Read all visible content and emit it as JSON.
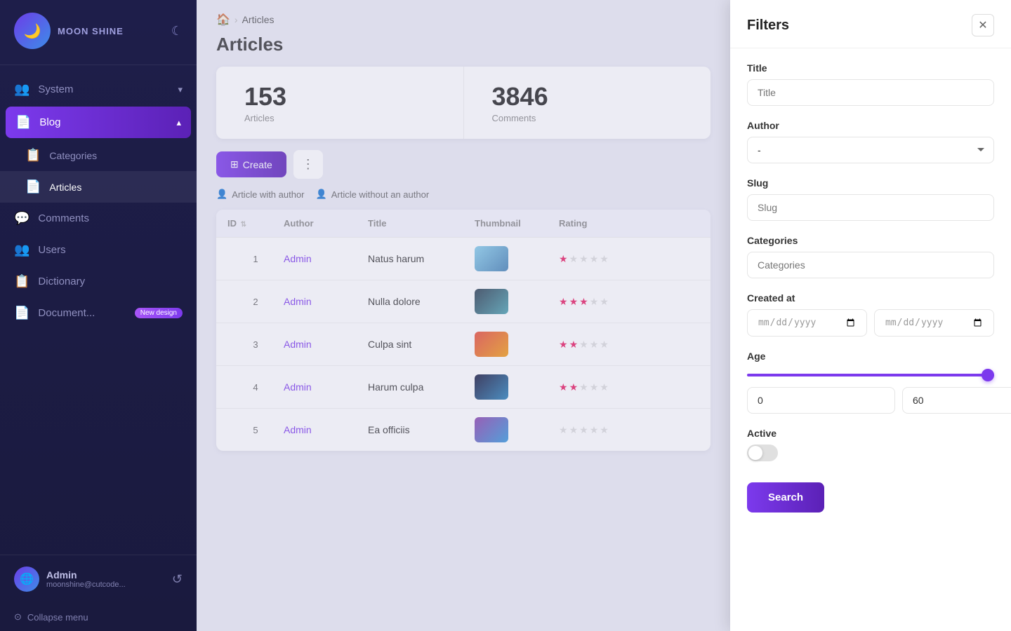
{
  "sidebar": {
    "logo": {
      "icon": "🌙",
      "text": "MOON SHINE"
    },
    "theme_icon": "☾",
    "nav": [
      {
        "id": "system",
        "label": "System",
        "icon": "👥",
        "hasChevron": true,
        "active": false
      },
      {
        "id": "blog",
        "label": "Blog",
        "icon": "📄",
        "hasChevron": true,
        "active": true,
        "expanded": true
      },
      {
        "id": "categories",
        "label": "Categories",
        "icon": "📋",
        "active": false,
        "sub": true
      },
      {
        "id": "articles",
        "label": "Articles",
        "icon": "📄",
        "active": true,
        "sub": true
      },
      {
        "id": "comments",
        "label": "Comments",
        "icon": "💬",
        "active": false
      },
      {
        "id": "users",
        "label": "Users",
        "icon": "👥",
        "active": false
      },
      {
        "id": "dictionary",
        "label": "Dictionary",
        "icon": "📋",
        "active": false
      },
      {
        "id": "documents",
        "label": "Document...",
        "icon": "📄",
        "active": false,
        "badge": "New design"
      }
    ],
    "user": {
      "name": "Admin",
      "email": "moonshine@cutcode...",
      "avatar": "🌐"
    },
    "collapse_label": "Collapse menu"
  },
  "breadcrumb": {
    "home_icon": "🏠",
    "separator": "›",
    "current": "Articles"
  },
  "page": {
    "title": "Articles"
  },
  "stats": [
    {
      "number": "153",
      "label": "Articles"
    },
    {
      "number": "3846",
      "label": "Comments"
    }
  ],
  "toolbar": {
    "create_label": "Create",
    "create_icon": "⊞",
    "more_icon": "⋮"
  },
  "filter_tabs": [
    {
      "id": "with-author",
      "label": "Article with author",
      "icon": "👤",
      "active": false
    },
    {
      "id": "without-author",
      "label": "Article without an author",
      "icon": "👤",
      "active": false
    }
  ],
  "table": {
    "headers": [
      "ID",
      "Author",
      "Title",
      "Thumbnail",
      "Rating",
      ""
    ],
    "rows": [
      {
        "id": "1",
        "author": "Admin",
        "title": "Natus harum",
        "thumb_class": "thumb-1",
        "stars": [
          1,
          0,
          0,
          0,
          0
        ]
      },
      {
        "id": "2",
        "author": "Admin",
        "title": "Nulla dolore",
        "thumb_class": "thumb-2",
        "stars": [
          1,
          1,
          1,
          0,
          0
        ]
      },
      {
        "id": "3",
        "author": "Admin",
        "title": "Culpa sint",
        "thumb_class": "thumb-3",
        "stars": [
          1,
          1,
          0,
          0,
          0
        ]
      },
      {
        "id": "4",
        "author": "Admin",
        "title": "Harum culpa",
        "thumb_class": "thumb-4",
        "stars": [
          1,
          1,
          0,
          0,
          0
        ]
      },
      {
        "id": "5",
        "author": "Admin",
        "title": "Ea officiis",
        "thumb_class": "thumb-5",
        "stars": [
          0,
          0,
          0,
          0,
          0
        ]
      }
    ]
  },
  "filters": {
    "title": "Filters",
    "close_icon": "✕",
    "fields": {
      "title_label": "Title",
      "title_placeholder": "Title",
      "author_label": "Author",
      "author_default": "-",
      "slug_label": "Slug",
      "slug_placeholder": "Slug",
      "categories_label": "Categories",
      "categories_placeholder": "Categories",
      "created_at_label": "Created at",
      "date_placeholder": "дд.мм.гггг",
      "age_label": "Age",
      "age_min": "0",
      "age_max": "60",
      "active_label": "Active"
    },
    "search_button": "Search"
  }
}
